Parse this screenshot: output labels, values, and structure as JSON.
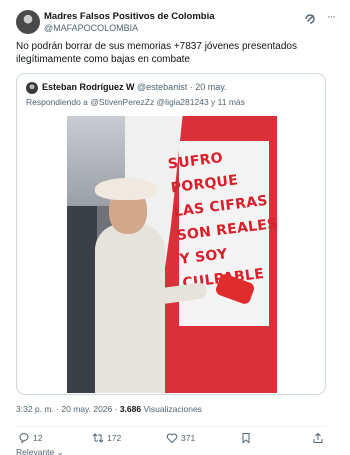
{
  "tweet": {
    "author_name": "Madres Falsos Positivos de Colombia",
    "author_handle": "@MAFAPOCOLOMBIA",
    "text": "No podrán borrar de sus memorias +7837 jóvenes presentados ilegítimamente como bajas en combate"
  },
  "quote": {
    "author_name": "Esteban Rodríguez W",
    "author_handle": "@estebanist",
    "date": "· 20 may.",
    "reply_prefix": "Respondiendo a",
    "reply_mentions": "@StivenPerezZz @ligia281243 y 11 más",
    "image_wall_text": "SUFRO PORQUE\nLAS CIFRAS\nSON REALES\nY SOY CULPABLE"
  },
  "meta": {
    "time": "3:32 p. m.",
    "date": "· 20 may. 2026 ·",
    "views_count": "3.686",
    "views_label": "Visualizaciones"
  },
  "actions": {
    "replies": "12",
    "reposts": "172",
    "likes": "371"
  },
  "footer": {
    "relevant_label": "Relevante ⌄"
  },
  "icons": [
    "grok-icon",
    "more-icon",
    "reply-icon",
    "repost-icon",
    "like-icon",
    "bookmark-icon",
    "share-icon"
  ]
}
